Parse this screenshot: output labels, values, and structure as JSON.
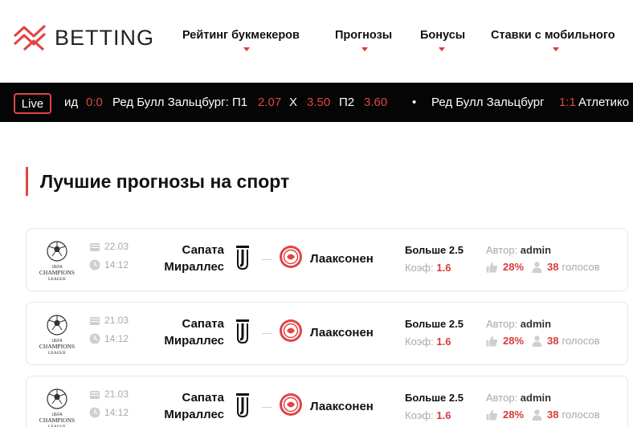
{
  "brand": {
    "name": "BETTING"
  },
  "nav": {
    "items": [
      {
        "label": "Рейтинг букмекеров"
      },
      {
        "label": "Прогнозы"
      },
      {
        "label": "Бонусы"
      },
      {
        "label": "Ставки с мобильного"
      }
    ]
  },
  "ticker": {
    "live_label": "Live",
    "partial_team": "ид",
    "partial_score": "0:0",
    "match1": "Ред Булл Зальцбург: П1",
    "p1": "2.07",
    "x_label": "Х",
    "x": "3.50",
    "p2_label": "П2",
    "p2": "3.60",
    "bullet": "•",
    "match2": "Ред Булл Зальцбург",
    "score2": "1:1",
    "match2_opponent": "Атлетико"
  },
  "section": {
    "title": "Лучшие прогнозы на спорт"
  },
  "league_text": {
    "line1": "CHAMPIONS",
    "line2": "LEAGUE"
  },
  "colors": {
    "accent": "#e04545",
    "ticker_bg": "#050505"
  },
  "cards": [
    {
      "date": "22.03",
      "time": "14:12",
      "player1": "Сапата",
      "player2": "Мираллес",
      "opponent": "Лааксонен",
      "forecast": "Больше 2.5",
      "coef_label": "Коэф:",
      "coef": "1.6",
      "author_label": "Автор:",
      "author": "admin",
      "percent": "28%",
      "votes": "38",
      "votes_label": "голосов"
    },
    {
      "date": "21.03",
      "time": "14:12",
      "player1": "Сапата",
      "player2": "Мираллес",
      "opponent": "Лааксонен",
      "forecast": "Больше 2.5",
      "coef_label": "Коэф:",
      "coef": "1.6",
      "author_label": "Автор:",
      "author": "admin",
      "percent": "28%",
      "votes": "38",
      "votes_label": "голосов"
    },
    {
      "date": "21.03",
      "time": "14:12",
      "player1": "Сапата",
      "player2": "Мираллес",
      "opponent": "Лааксонен",
      "forecast": "Больше 2.5",
      "coef_label": "Коэф:",
      "coef": "1.6",
      "author_label": "Автор:",
      "author": "admin",
      "percent": "28%",
      "votes": "38",
      "votes_label": "голосов"
    }
  ]
}
